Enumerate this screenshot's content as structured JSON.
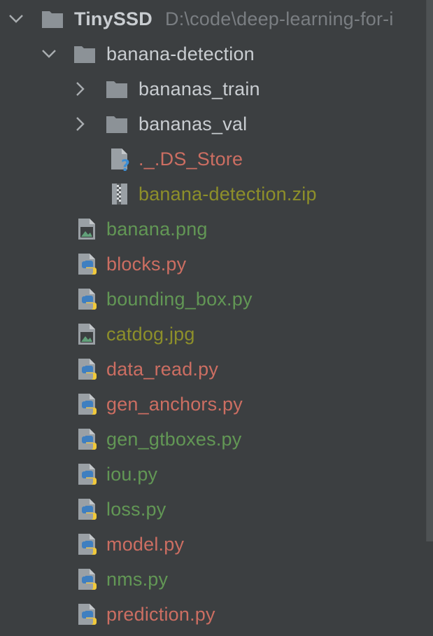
{
  "project": {
    "name": "TinySSD",
    "path": "D:\\code\\deep-learning-for-i"
  },
  "tree": {
    "banana_detection": {
      "label": "banana-detection",
      "children": {
        "bananas_train": "bananas_train",
        "bananas_val": "bananas_val",
        "ds_store": "._.DS_Store",
        "zip": "banana-detection.zip"
      }
    },
    "files": [
      {
        "label": "banana.png",
        "type": "image",
        "color": "#629755"
      },
      {
        "label": "blocks.py",
        "type": "python",
        "color": "#cc6e62"
      },
      {
        "label": "bounding_box.py",
        "type": "python",
        "color": "#629755"
      },
      {
        "label": "catdog.jpg",
        "type": "image",
        "color": "#8d8f2a"
      },
      {
        "label": "data_read.py",
        "type": "python",
        "color": "#cc6e62"
      },
      {
        "label": "gen_anchors.py",
        "type": "python",
        "color": "#cc6e62"
      },
      {
        "label": "gen_gtboxes.py",
        "type": "python",
        "color": "#629755"
      },
      {
        "label": "iou.py",
        "type": "python",
        "color": "#629755"
      },
      {
        "label": "loss.py",
        "type": "python",
        "color": "#629755"
      },
      {
        "label": "model.py",
        "type": "python",
        "color": "#cc6e62"
      },
      {
        "label": "nms.py",
        "type": "python",
        "color": "#629755"
      },
      {
        "label": "prediction.py",
        "type": "python",
        "color": "#cc6e62"
      }
    ]
  },
  "icons": {
    "folder": "folder-icon",
    "python": "python-file-icon",
    "image": "image-file-icon",
    "unknown": "unknown-file-icon",
    "archive": "archive-file-icon",
    "chevron_down": "chevron-down-icon",
    "chevron_right": "chevron-right-icon"
  }
}
